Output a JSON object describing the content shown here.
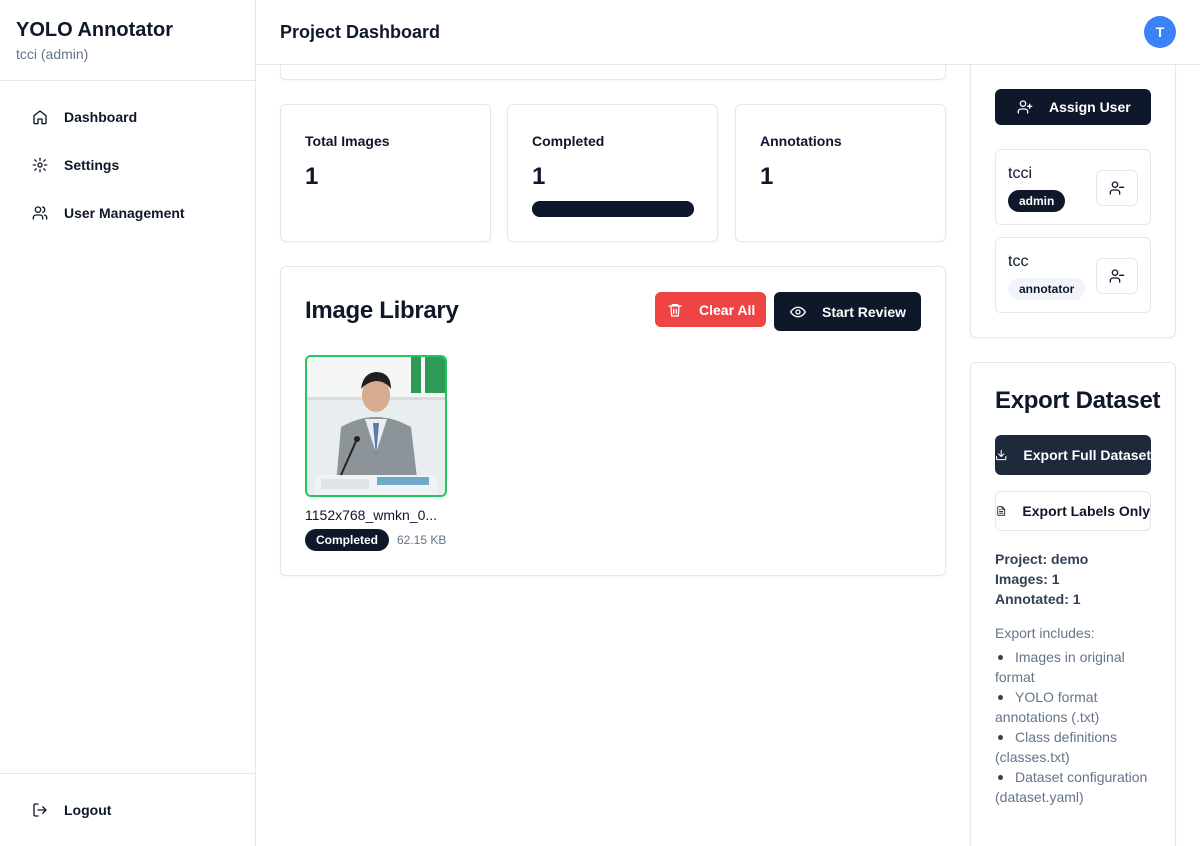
{
  "app": {
    "title": "YOLO Annotator",
    "user": "tcci (admin)"
  },
  "sidebar": {
    "items": [
      {
        "label": "Dashboard",
        "icon": "home-icon"
      },
      {
        "label": "Settings",
        "icon": "gear-icon"
      },
      {
        "label": "User Management",
        "icon": "users-icon"
      }
    ],
    "logout": {
      "label": "Logout",
      "icon": "logout-icon"
    }
  },
  "header": {
    "title": "Project Dashboard",
    "avatar_initial": "T",
    "avatar_color": "#3b82f6"
  },
  "stats": [
    {
      "label": "Total Images",
      "value": "1"
    },
    {
      "label": "Completed",
      "value": "1",
      "progress": 1.0
    },
    {
      "label": "Annotations",
      "value": "1"
    }
  ],
  "library": {
    "title": "Image Library",
    "clear_all": "Clear All",
    "start_review": "Start Review",
    "images": [
      {
        "name": "1152x768_wmkn_0...",
        "status": "Completed",
        "size": "62.15 KB"
      }
    ]
  },
  "users": {
    "assign_label": "Assign User",
    "list": [
      {
        "name": "tcci",
        "role": "admin"
      },
      {
        "name": "tcc",
        "role": "annotator"
      }
    ]
  },
  "export": {
    "title": "Export Dataset",
    "full_label": "Export Full Dataset",
    "labels_label": "Export Labels Only",
    "project": "Project: demo",
    "images": "Images: 1",
    "annotated": "Annotated: 1",
    "includes_title": "Export includes:",
    "includes": [
      "Images in original format",
      "YOLO format annotations (.txt)",
      "Class definitions (classes.txt)",
      "Dataset configuration (dataset.yaml)"
    ]
  },
  "colors": {
    "danger": "#ef4444",
    "dark": "#0f172a",
    "success_border": "#22c55e"
  }
}
